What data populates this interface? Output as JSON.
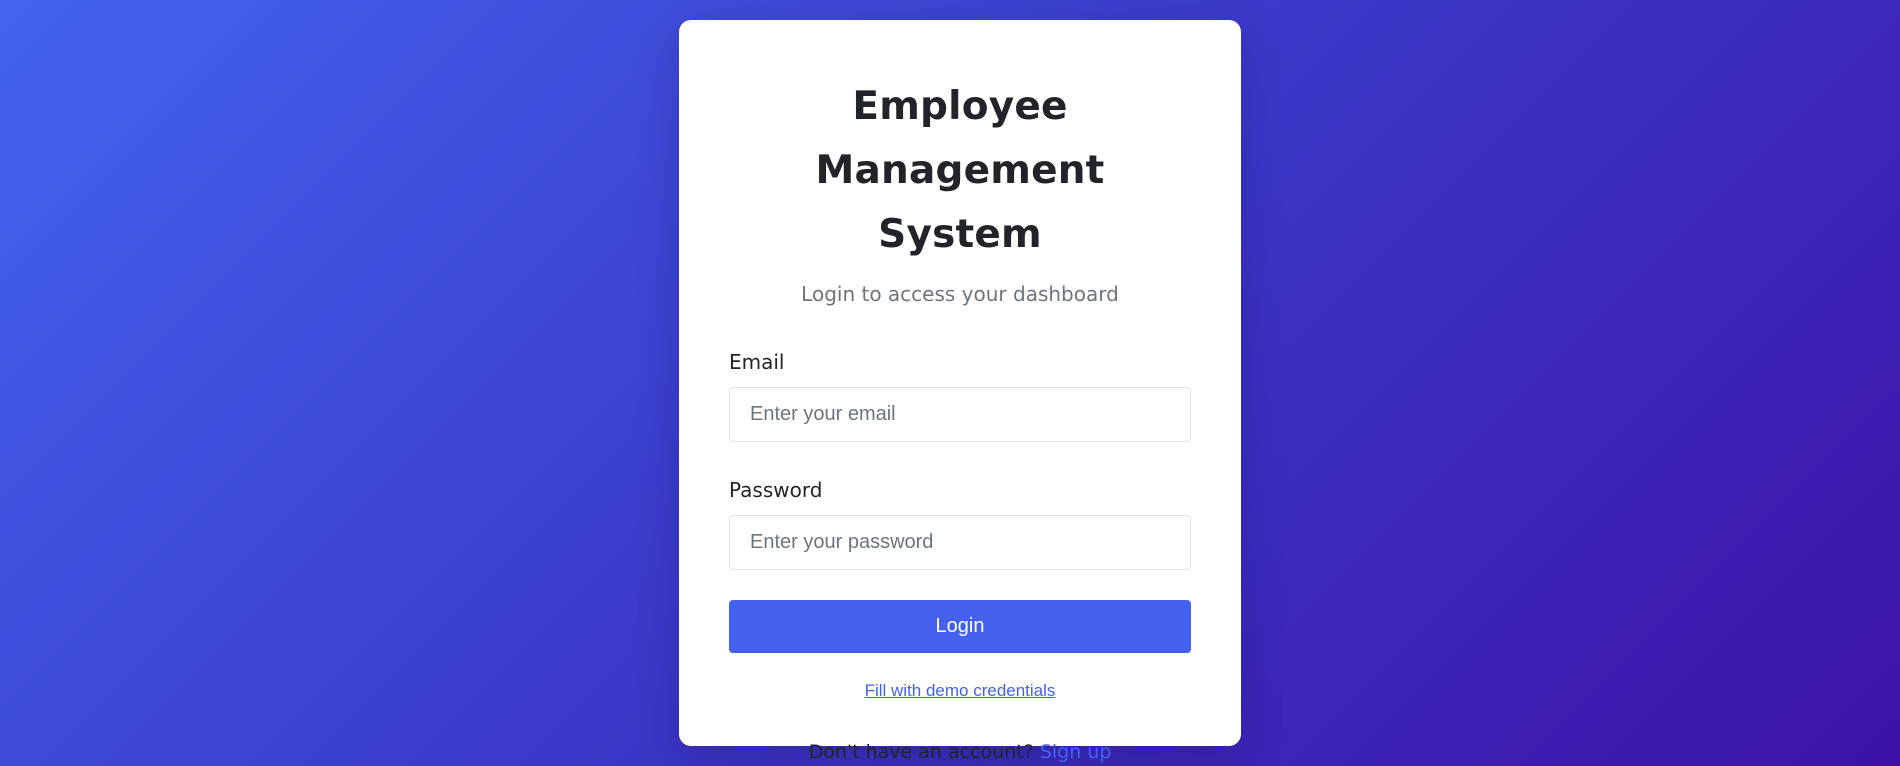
{
  "login_card": {
    "title_line1": "Employee",
    "title_line2": "Management System",
    "subtitle": "Login to access your dashboard",
    "email_label": "Email",
    "email_placeholder": "Enter your email",
    "email_value": "",
    "password_label": "Password",
    "password_placeholder": "Enter your password",
    "password_value": "",
    "login_button_label": "Login",
    "demo_link_label": "Fill with demo credentials",
    "signup_prompt": "Don't have an account?",
    "signup_link_label": "Sign up"
  },
  "colors": {
    "accent": "#4361ee",
    "background_start": "#4364ed",
    "background_end": "#3c12a6",
    "card": "#ffffff",
    "text_primary": "#212529",
    "text_muted": "#6c757d"
  }
}
